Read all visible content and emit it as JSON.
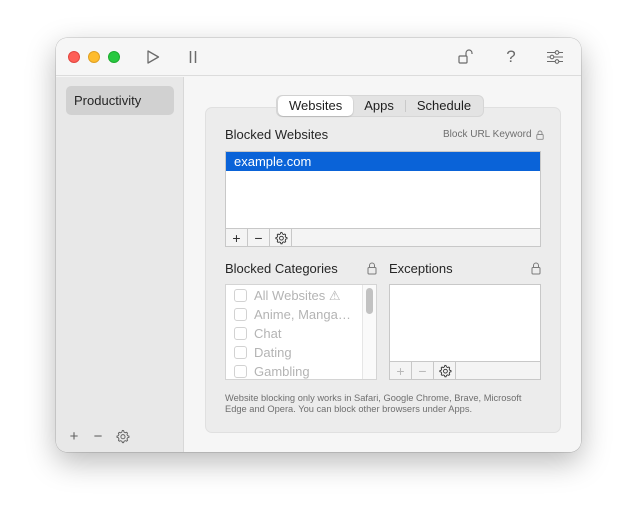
{
  "window": {
    "toolbar": {
      "play_icon": "play-icon",
      "pause_icon": "pause-icon",
      "lock_icon": "unlocked-lock-icon",
      "help_label": "?",
      "settings_icon": "sliders-icon"
    }
  },
  "sidebar": {
    "items": [
      {
        "label": "Productivity",
        "selected": true
      }
    ],
    "footer": {
      "add": "+",
      "remove": "−",
      "settings_icon": "gear-icon"
    }
  },
  "tabs": [
    {
      "label": "Websites",
      "active": true
    },
    {
      "label": "Apps",
      "active": false
    },
    {
      "label": "Schedule",
      "active": false
    }
  ],
  "blocked_websites": {
    "title": "Blocked Websites",
    "keyword_link": "Block URL Keyword",
    "items": [
      {
        "label": "example.com",
        "selected": true
      }
    ],
    "toolbar": {
      "add": "+",
      "remove": "−",
      "settings_icon": "gear-icon"
    }
  },
  "blocked_categories": {
    "title": "Blocked Categories",
    "items": [
      {
        "label": "All Websites ⚠",
        "checked": false
      },
      {
        "label": "Anime, Manga…",
        "checked": false
      },
      {
        "label": "Chat",
        "checked": false
      },
      {
        "label": "Dating",
        "checked": false
      },
      {
        "label": "Gambling",
        "checked": false
      }
    ]
  },
  "exceptions": {
    "title": "Exceptions",
    "items": [],
    "toolbar": {
      "add": "+",
      "remove": "−",
      "settings_icon": "gear-icon"
    }
  },
  "footnote": "Website blocking only works in Safari, Google Chrome, Brave, Microsoft Edge and Opera. You can block other browsers under Apps.",
  "colors": {
    "accent": "#0a63d8",
    "close": "#fe5f57",
    "minimize": "#febc2e",
    "maximize": "#28c840"
  }
}
